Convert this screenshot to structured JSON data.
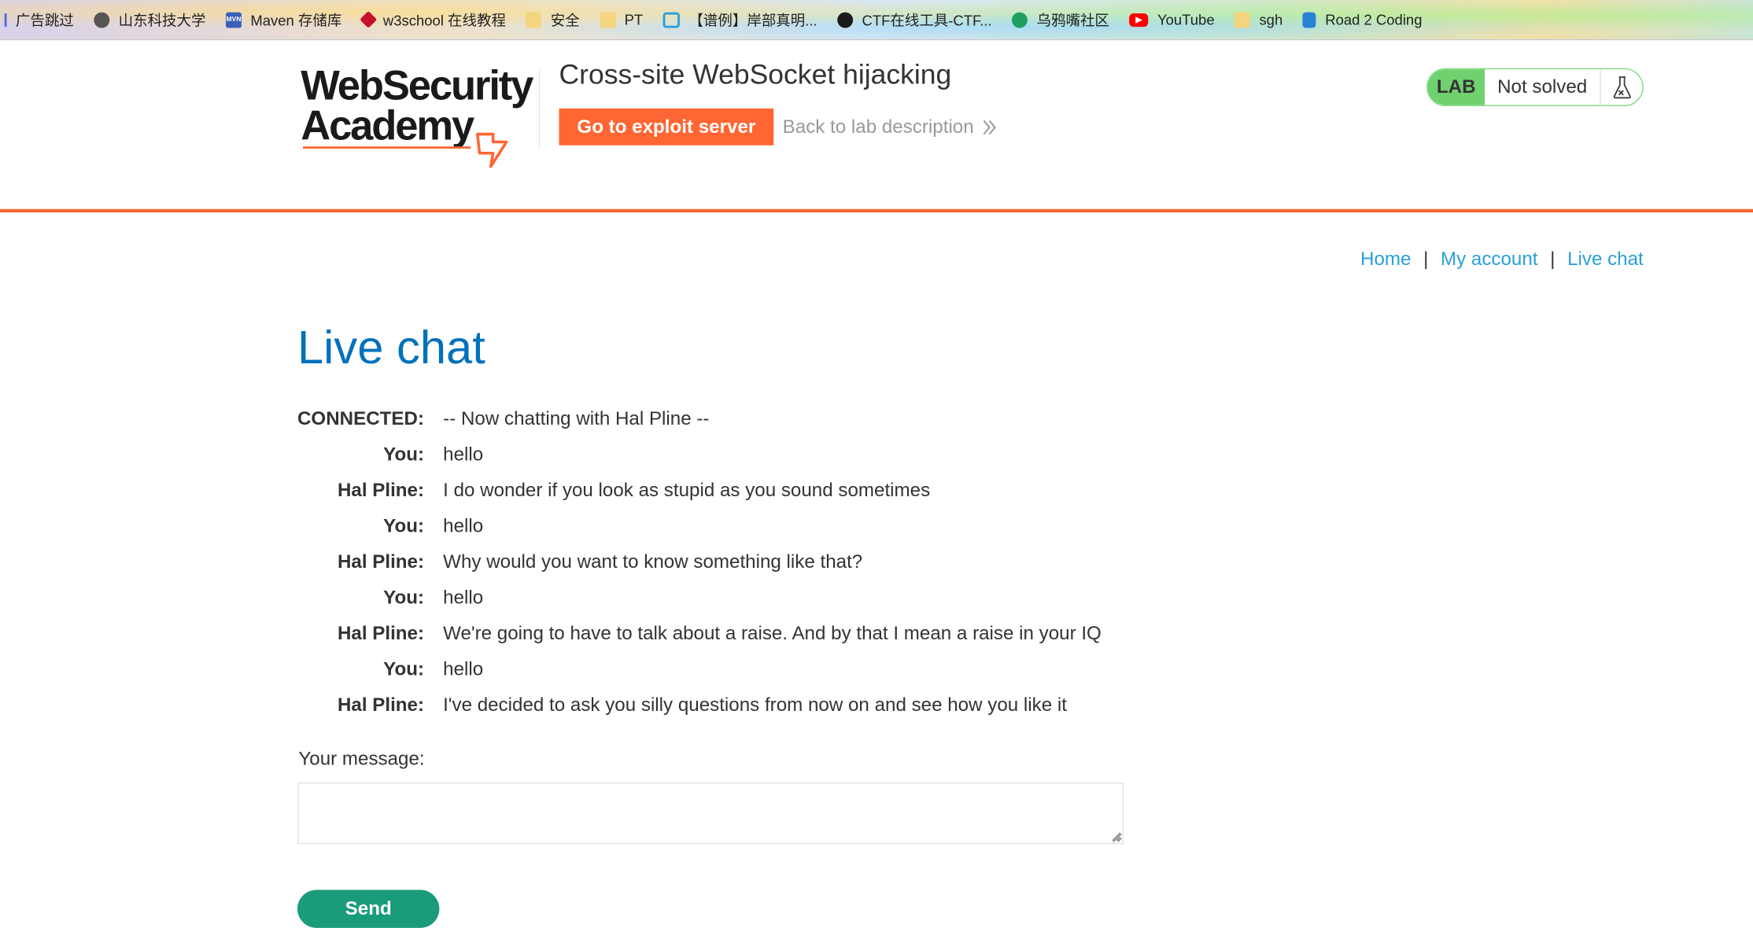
{
  "bookmarks": [
    {
      "label": "广告跳过",
      "icon": "divider-bar-icon"
    },
    {
      "label": "山东科技大学",
      "icon": "globe-icon"
    },
    {
      "label": "Maven 存储库",
      "icon": "mvn-icon",
      "icon_text": "MVN"
    },
    {
      "label": "w3school 在线教程",
      "icon": "w3school-icon"
    },
    {
      "label": "安全",
      "icon": "folder-icon"
    },
    {
      "label": "PT",
      "icon": "folder-icon"
    },
    {
      "label": "【谱例】岸部真明...",
      "icon": "bilibili-icon"
    },
    {
      "label": "CTF在线工具-CTF...",
      "icon": "ctf-icon"
    },
    {
      "label": "乌鸦嘴社区",
      "icon": "wuya-icon"
    },
    {
      "label": "YouTube",
      "icon": "youtube-icon"
    },
    {
      "label": "sgh",
      "icon": "folder-icon"
    },
    {
      "label": "Road 2 Coding",
      "icon": "road2coding-icon"
    }
  ],
  "header": {
    "logo_line1": "WebSecurity",
    "logo_line2": "Academy",
    "lab_title": "Cross-site WebSocket hijacking",
    "exploit_button": "Go to exploit server",
    "back_link": "Back to lab description",
    "lab_badge": "LAB",
    "lab_state": "Not solved"
  },
  "nav": {
    "home": "Home",
    "my_account": "My account",
    "live_chat": "Live chat",
    "separator": "|"
  },
  "page": {
    "title": "Live chat"
  },
  "chat": [
    {
      "who": "CONNECTED:",
      "text": "-- Now chatting with Hal Pline --"
    },
    {
      "who": "You:",
      "text": "hello"
    },
    {
      "who": "Hal Pline:",
      "text": "I do wonder if you look as stupid as you sound sometimes"
    },
    {
      "who": "You:",
      "text": "hello"
    },
    {
      "who": "Hal Pline:",
      "text": "Why would you want to know something like that?"
    },
    {
      "who": "You:",
      "text": "hello"
    },
    {
      "who": "Hal Pline:",
      "text": "We're going to have to talk about a raise. And by that I mean a raise in your IQ"
    },
    {
      "who": "You:",
      "text": "hello"
    },
    {
      "who": "Hal Pline:",
      "text": "I've decided to ask you silly questions from now on and see how you like it"
    }
  ],
  "form": {
    "label": "Your message:",
    "value": "",
    "send_button": "Send"
  },
  "colors": {
    "accent": "#ff6633",
    "link": "#2a9fd8",
    "title": "#0071bc",
    "lab_green": "#70d16f",
    "send": "#1a9c7a"
  }
}
